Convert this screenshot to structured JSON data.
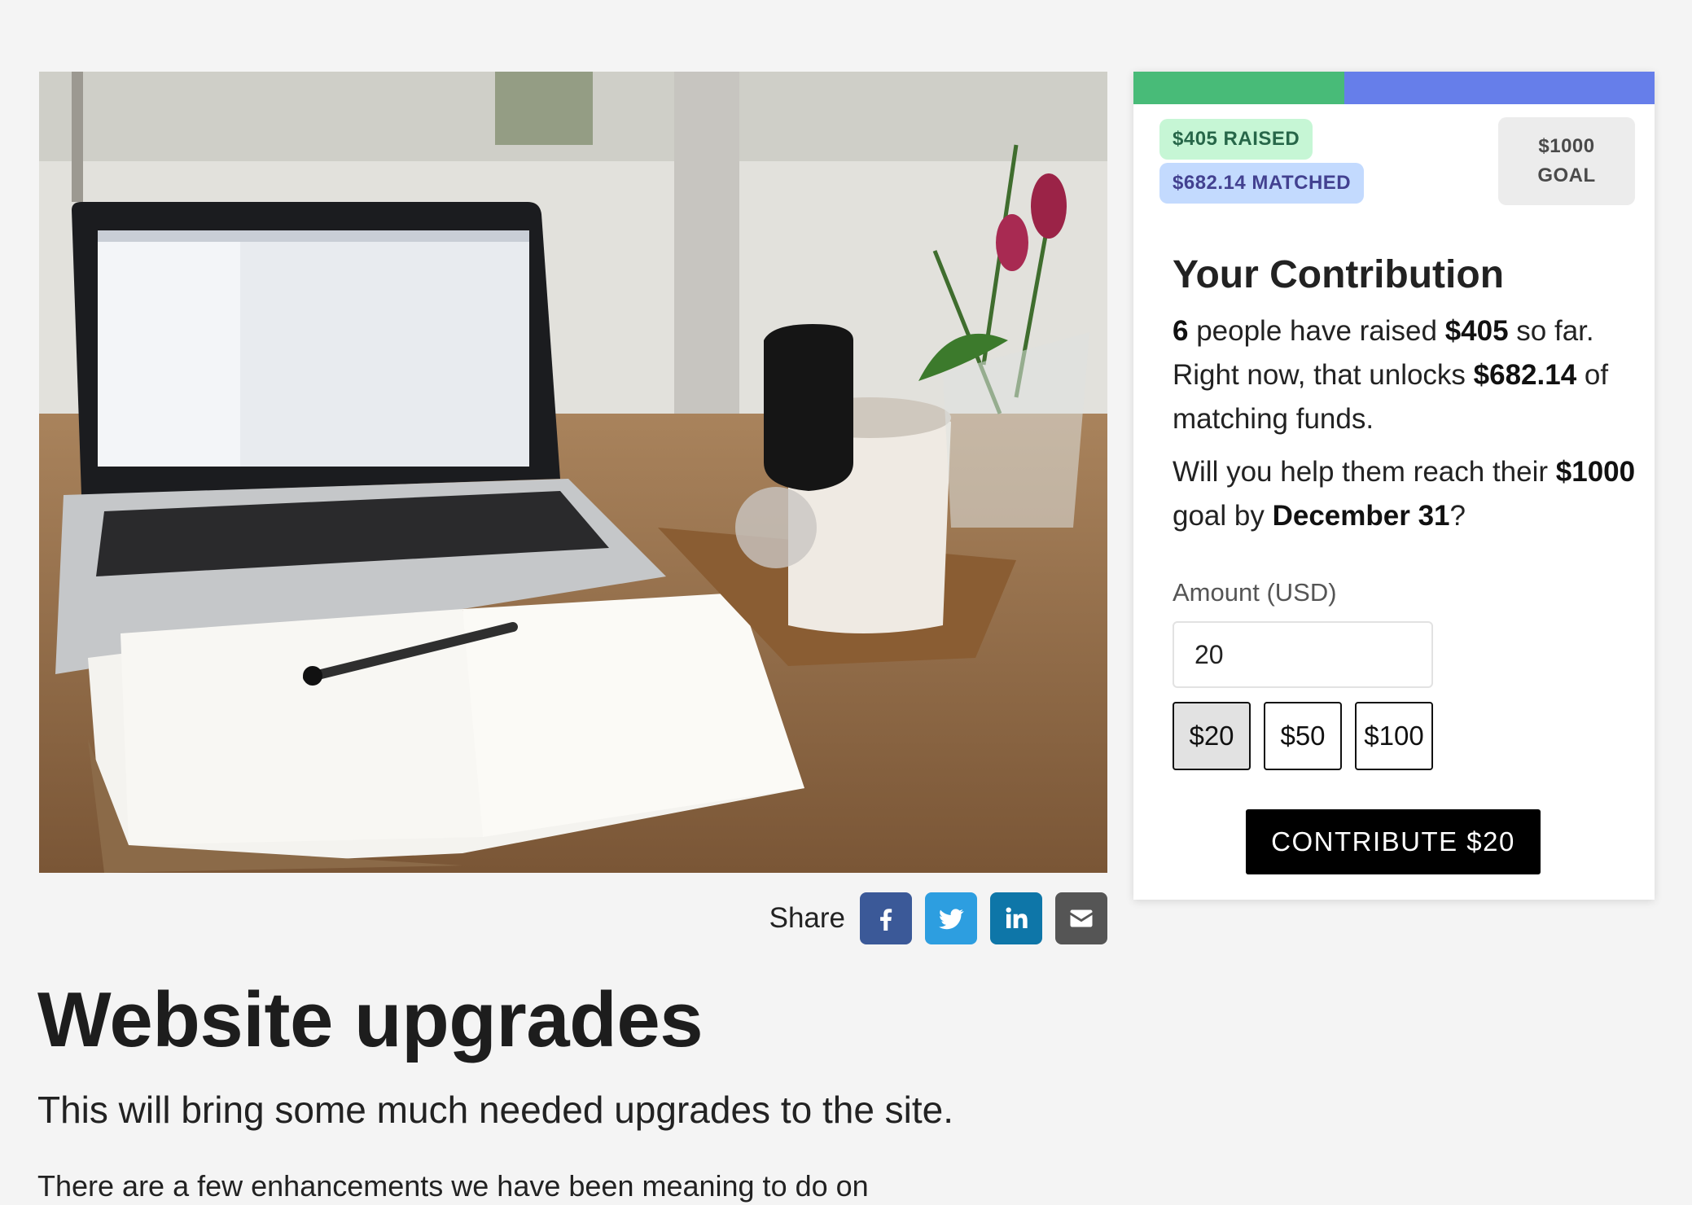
{
  "hero": {
    "image_desc": "Laptop, open notebook with pen, white mug and flowers on a wooden desk"
  },
  "share": {
    "label": "Share",
    "buttons": [
      {
        "name": "facebook",
        "color": "#3b5998",
        "icon": "facebook-icon"
      },
      {
        "name": "twitter",
        "color": "#2d9ee0",
        "icon": "twitter-icon"
      },
      {
        "name": "linkedin",
        "color": "#0e76a8",
        "icon": "linkedin-icon"
      },
      {
        "name": "email",
        "color": "#555555",
        "icon": "envelope-icon"
      }
    ]
  },
  "project": {
    "title": "Website upgrades",
    "subtitle": "This will bring some much needed upgrades to the site.",
    "body_start": "There are a few enhancements we have been meaning to do on"
  },
  "campaign": {
    "progress": {
      "raised_fraction": 0.405,
      "matched_color": "#667eea",
      "raised_color": "#48bb78"
    },
    "raised_badge": "$405 RAISED",
    "matched_badge": "$682.14 MATCHED",
    "goal_amount": "$1000",
    "goal_label": "GOAL",
    "heading": "Your Contribution",
    "people_count": "6",
    "text_people": " people have raised ",
    "raised_amount": "$405",
    "text_so_far": " so far. Right now, that unlocks ",
    "matched_amount": "$682.14",
    "text_matching": " of matching funds.",
    "text_help": "Will you help them reach their ",
    "goal_inline": "$1000",
    "text_goal_by": " goal by ",
    "deadline": "December 31",
    "text_q": "?",
    "amount_label": "Amount (USD)",
    "amount_value": "20",
    "presets": [
      "$20",
      "$50",
      "$100"
    ],
    "selected_preset": "$20",
    "cta": "CONTRIBUTE $20"
  }
}
